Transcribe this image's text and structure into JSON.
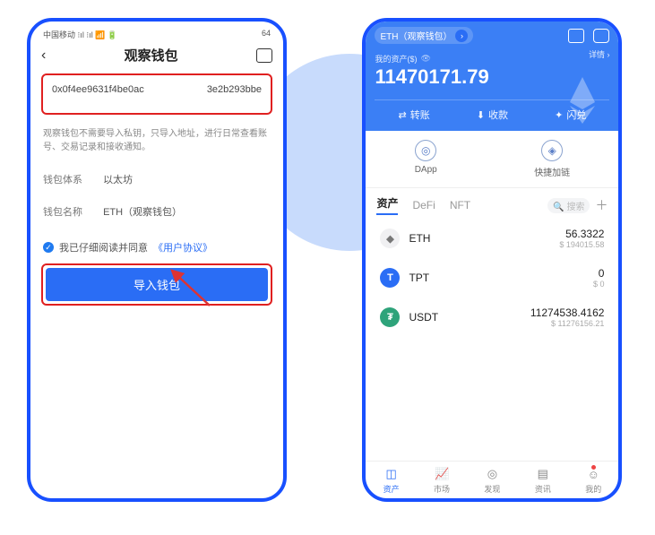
{
  "left": {
    "status": {
      "left": "中国移动 ⁝ıl ⁝ıl 📶 🔋",
      "right": "64"
    },
    "title": "观察钱包",
    "address": {
      "part1": "0x0f4ee9631f4be0ac",
      "part2": "3e2b293bbe"
    },
    "description": "观察钱包不需要导入私钥，只导入地址，进行日常查看账号、交易记录和接收通知。",
    "system_label": "钱包体系",
    "system_value": "以太坊",
    "name_label": "钱包名称",
    "name_value": "ETH（观察钱包）",
    "agree_text": "我已仔细阅读并同意",
    "agreement_link": "《用户协议》",
    "import_btn": "导入钱包"
  },
  "right": {
    "pill_chain": "ETH（观察钱包）",
    "assets_label": "我的资产($)",
    "assets_value": "11470171.79",
    "details": "详情 ›",
    "actions": {
      "transfer": "转账",
      "receive": "收款",
      "swap": "闪兑"
    },
    "quick": {
      "dapp": "DApp",
      "link": "快捷加链"
    },
    "tabs": {
      "assets": "资产",
      "defi": "DeFi",
      "nft": "NFT",
      "search": "搜索"
    },
    "assets": [
      {
        "symbol": "ETH",
        "amount": "56.3322",
        "fiat": "$ 194015.58"
      },
      {
        "symbol": "TPT",
        "amount": "0",
        "fiat": "$ 0"
      },
      {
        "symbol": "USDT",
        "amount": "11274538.4162",
        "fiat": "$ 11276156.21"
      }
    ],
    "nav": {
      "assets": "资产",
      "market": "市场",
      "discover": "发现",
      "news": "资讯",
      "me": "我的"
    }
  }
}
